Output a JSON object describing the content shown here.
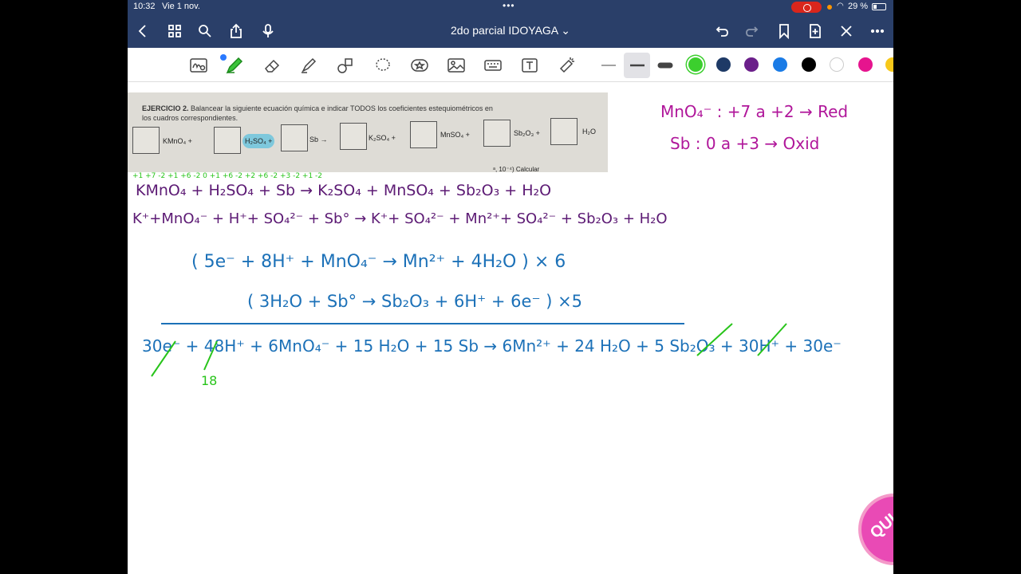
{
  "status": {
    "time": "10:32",
    "date": "Vie 1 nov.",
    "battery": "29 %"
  },
  "nav": {
    "title": "2do parcial IDOYAGA ⌄"
  },
  "colors": {
    "nav_bg": "#2a3f69",
    "purple_ink": "#5c1a74",
    "blue_ink": "#1c71b8",
    "green_ink": "#28c41a",
    "magenta_ink": "#b0169a"
  },
  "exercise": {
    "title": "EJERCICIO 2.",
    "instruction": "Balancear la siguiente ecuación química e indicar TODOS los coeficientes estequiométricos en",
    "instruction2": "los cuadros correspondientes.",
    "species": [
      "KMnO₄ +",
      "H₂SO₄ +",
      "Sb →",
      "K₂SO₄ +",
      "MnSO₄ +",
      "Sb₂O₃ +",
      "H₂O"
    ],
    "cutoff": "ᵃ, 10⁻⁴) Calcular"
  },
  "notes": {
    "redox1": "MnO₄⁻ : +7 a +2 → Red",
    "redox2": "Sb  : 0 a +3 → Oxid"
  },
  "equations": {
    "ox_states_line": "+1 +7 -2        +1  +6 -2       0            +1  +6 -2      +2 +6 -2      +3  -2        +1  -2",
    "molecular": "KMnO₄  + H₂SO₄  +  Sb  →  K₂SO₄ + MnSO₄ +  Sb₂O₃  + H₂O",
    "ionic": "K⁺+MnO₄⁻ + H⁺+ SO₄²⁻ + Sb°  → K⁺+ SO₄²⁻ + Mn²⁺+ SO₄²⁻ + Sb₂O₃ + H₂O",
    "half_reduction": "( 5e⁻  +  8H⁺  +  MnO₄⁻  →  Mn²⁺  +  4H₂O )  × 6",
    "half_oxidation": "( 3H₂O   +  Sb°  →   Sb₂O₃  +  6H⁺ + 6e⁻ ) ×5",
    "sum": "30e⁻ + 48H⁺ + 6MnO₄⁻ + 15 H₂O + 15 Sb → 6Mn²⁺ + 24 H₂O + 5 Sb₂O₃ + 30H⁺ + 30e⁻",
    "note_18": "18"
  },
  "logo_text": "QUI"
}
